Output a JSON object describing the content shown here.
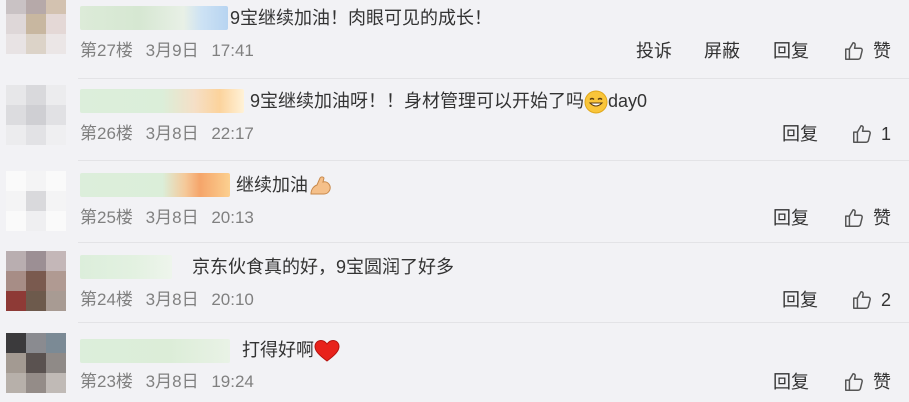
{
  "comments": [
    {
      "text": "9宝继续加油！肉眼可见的成长！",
      "floor": "第27楼",
      "date": "3月9日",
      "time": "17:41",
      "actions": {
        "report": "投诉",
        "block": "屏蔽",
        "reply": "回复"
      },
      "like": "赞"
    },
    {
      "text": "9宝继续加油呀！！身材管理可以开始了吗",
      "text_suffix": "day0",
      "emoji": "grin-emoji",
      "floor": "第26楼",
      "date": "3月8日",
      "time": "22:17",
      "actions": {
        "reply": "回复"
      },
      "like": "1"
    },
    {
      "text": "继续加油",
      "emoji": "flexed-arm-emoji",
      "floor": "第25楼",
      "date": "3月8日",
      "time": "20:13",
      "actions": {
        "reply": "回复"
      },
      "like": "赞"
    },
    {
      "text": "京东伙食真的好，9宝圆润了好多",
      "floor": "第24楼",
      "date": "3月8日",
      "time": "20:10",
      "actions": {
        "reply": "回复"
      },
      "like": "2"
    },
    {
      "text": "打得好啊",
      "emoji": "red-heart-emoji",
      "floor": "第23楼",
      "date": "3月8日",
      "time": "19:24",
      "actions": {
        "reply": "回复"
      },
      "like": "赞"
    }
  ]
}
